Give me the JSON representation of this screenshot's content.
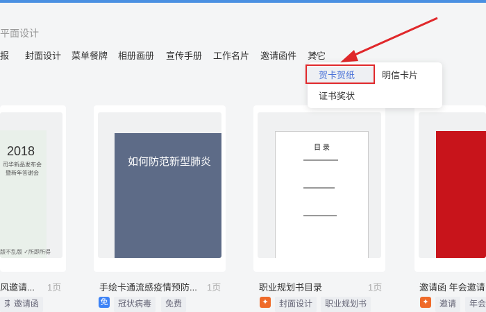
{
  "breadcrumb": "平面设计",
  "categories": [
    "报",
    "封面设计",
    "菜单餐牌",
    "相册画册",
    "宣传手册",
    "工作名片",
    "邀请函件",
    "其它"
  ],
  "dropdown": {
    "items": [
      "贺卡贺纸",
      "明信卡片",
      "证书奖状"
    ]
  },
  "cards": [
    {
      "title": "风邀请...",
      "pages": "1页",
      "tags": [
        "束",
        "邀请函"
      ],
      "poster_year": "2018",
      "poster_line1": "司华新品发布会",
      "poster_line2": "暨新年答谢会",
      "poster_foot": "版不乱版 ✓所即所得"
    },
    {
      "title": "手绘卡通流感疫情预防...",
      "pages": "1页",
      "badge": "免",
      "tags": [
        "冠状病毒",
        "免费"
      ],
      "poster_heading": "如何防范新型肺炎"
    },
    {
      "title": "职业规划书目录",
      "pages": "1页",
      "tags": [
        "封面设计",
        "职业规划书"
      ],
      "poster_heading": "目 录"
    },
    {
      "title": "邀请函 年会邀请",
      "tags": [
        "邀请",
        "年会"
      ]
    }
  ],
  "colors": {
    "accent": "#4a72d8",
    "highlight": "#e0282b",
    "badge_green": "#3b82f6",
    "badge_orange": "#ef6b2a"
  }
}
